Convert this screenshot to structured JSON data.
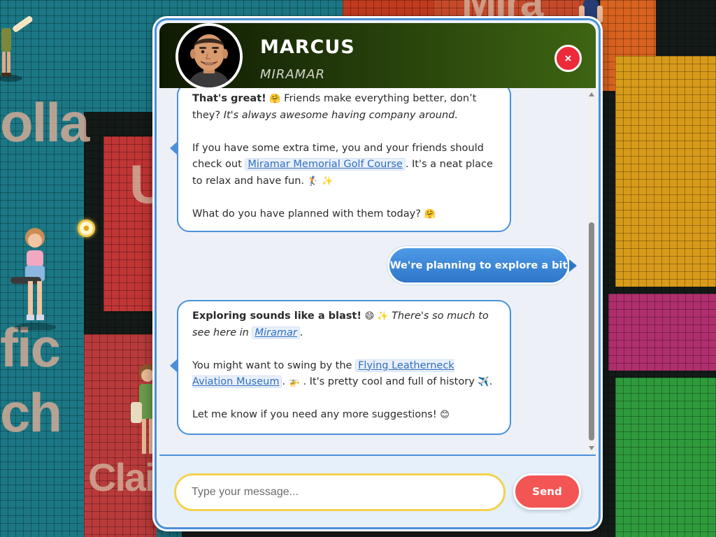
{
  "map": {
    "labels": {
      "ja_olla": "olla",
      "university": "U",
      "pacific": "fic",
      "beach": "ch",
      "clairemont": "Clair",
      "mira": "Mira"
    }
  },
  "chat": {
    "character": {
      "name": "MARCUS",
      "location": "MIRAMAR"
    },
    "close_label": "×",
    "messages": [
      {
        "role": "ai",
        "p1_bold": "That's great!",
        "p1_emoji": "🤗",
        "p1_text": "Friends make everything better, don’t they?",
        "p1_italic": "It's always awesome having company around.",
        "p2_pre": "If you have some extra time, you and your friends should check out",
        "p2_link": "Miramar Memorial Golf Course",
        "p2_post": ". It's a neat place to relax and have fun.",
        "p2_emoji": "🏌️ ✨",
        "p3_text": "What do you have planned with them today?",
        "p3_emoji": "🤗"
      },
      {
        "role": "user",
        "text": "We're planning to explore a bit"
      },
      {
        "role": "ai",
        "p1_bold": "Exploring sounds like a blast!",
        "p1_emoji": "😄 ✨",
        "p1_italic": "There's so much to see here in",
        "p1_link": "Miramar",
        "p1_end": ".",
        "p2_pre": "You might want to swing by the",
        "p2_link": "Flying Leatherneck Aviation Museum",
        "p2_emoji1": "🚁",
        "p2_post": ". It's pretty cool and full of history",
        "p2_emoji2": "✈️",
        "p2_end": ".",
        "p3_text": "Let me know if you need any more suggestions!",
        "p3_emoji": "😊"
      }
    ],
    "input": {
      "placeholder": "Type your message...",
      "value": ""
    },
    "send_label": "Send"
  }
}
